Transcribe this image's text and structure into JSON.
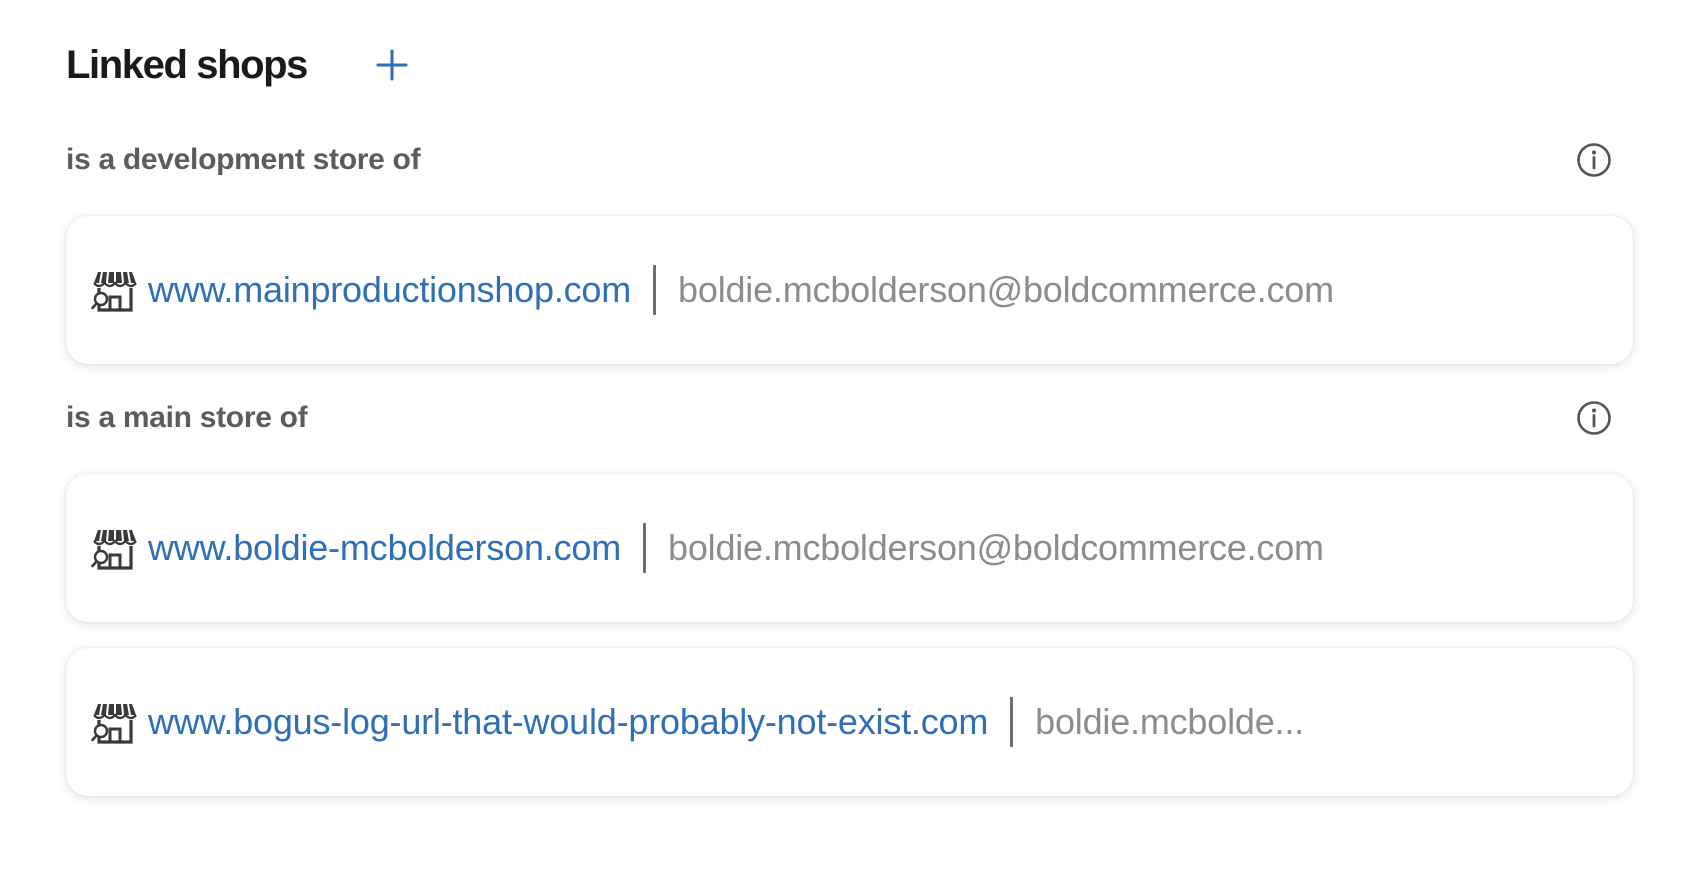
{
  "header": {
    "title": "Linked shops",
    "add_icon": "plus-icon"
  },
  "colors": {
    "link": "#2e6fb7",
    "label": "#5c5c5c",
    "muted": "#8c8c8c",
    "accent": "#2e6fb7"
  },
  "sections": [
    {
      "label": "is a development store of",
      "info_icon": "info-icon",
      "shops": [
        {
          "icon": "storefront-icon",
          "url": "www.mainproductionshop.com",
          "email": "boldie.mcbolderson@boldcommerce.com"
        }
      ]
    },
    {
      "label": "is a main store of",
      "info_icon": "info-icon",
      "shops": [
        {
          "icon": "storefront-icon",
          "url": "www.boldie-mcbolderson.com",
          "email": "boldie.mcbolderson@boldcommerce.com"
        },
        {
          "icon": "storefront-icon",
          "url": "www.bogus-log-url-that-would-probably-not-exist.com",
          "email": "boldie.mcbolde..."
        }
      ]
    }
  ]
}
